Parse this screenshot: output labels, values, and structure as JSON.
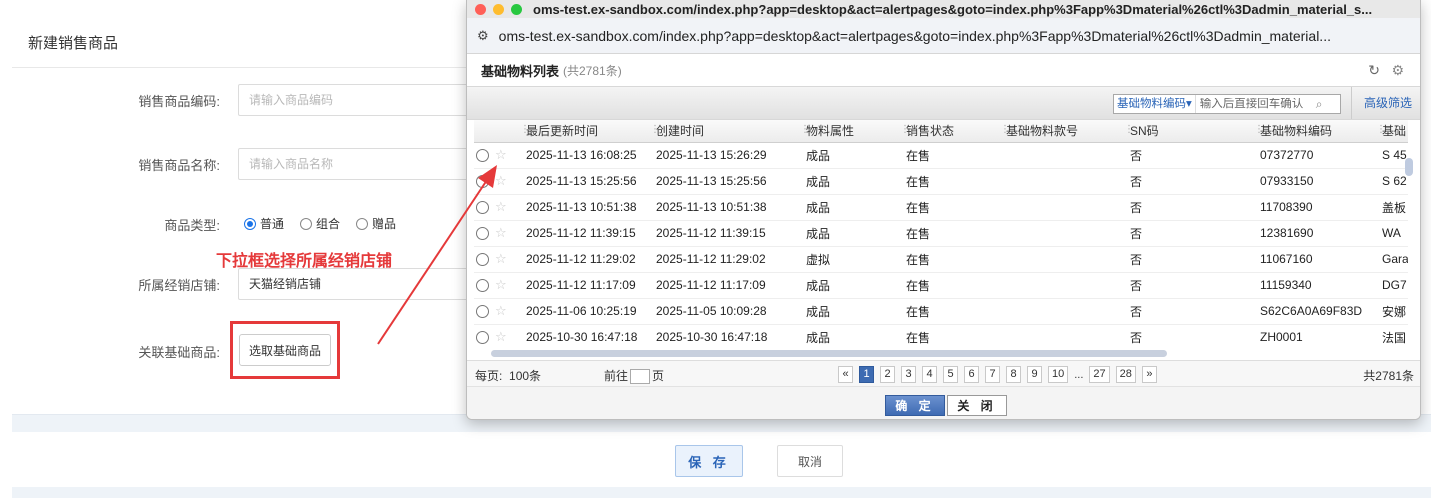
{
  "form": {
    "title": "新建销售商品",
    "code_label": "销售商品编码:",
    "code_placeholder": "请输入商品编码",
    "name_label": "销售商品名称:",
    "name_placeholder": "请输入商品名称",
    "type_label": "商品类型:",
    "type_options": [
      "普通",
      "组合",
      "赠品"
    ],
    "type_selected": "普通",
    "store_label": "所属经销店铺:",
    "store_value": "天猫经销店铺",
    "basic_label": "关联基础商品:",
    "pick_button": "选取基础商品",
    "annotation": "下拉框选择所属经销店铺",
    "save_button": "保 存",
    "cancel_button": "取消"
  },
  "popup": {
    "window_title": "oms-test.ex-sandbox.com/index.php?app=desktop&act=alertpages&goto=index.php%3Fapp%3Dmaterial%26ctl%3Dadmin_material_s...",
    "url": "oms-test.ex-sandbox.com/index.php?app=desktop&act=alertpages&goto=index.php%3Fapp%3Dmaterial%26ctl%3Dadmin_material...",
    "list_title": "基础物料列表",
    "list_count": "(共2781条)",
    "search_field": "基础物料编码▾",
    "search_placeholder": "输入后直接回车确认",
    "advanced_filter": "高级筛选",
    "columns": [
      "最后更新时间",
      "创建时间",
      "物料属性",
      "销售状态",
      "基础物料款号",
      "SN码",
      "基础物料编码",
      "基础"
    ],
    "rows": [
      [
        "2025-11-13 16:08:25",
        "2025-11-13 15:26:29",
        "成品",
        "在售",
        "",
        "否",
        "07372770",
        "S 45"
      ],
      [
        "2025-11-13 15:25:56",
        "2025-11-13 15:25:56",
        "成品",
        "在售",
        "",
        "否",
        "07933150",
        "S 62"
      ],
      [
        "2025-11-13 10:51:38",
        "2025-11-13 10:51:38",
        "成品",
        "在售",
        "",
        "否",
        "11708390",
        "盖板"
      ],
      [
        "2025-11-12 11:39:15",
        "2025-11-12 11:39:15",
        "成品",
        "在售",
        "",
        "否",
        "12381690",
        "WA"
      ],
      [
        "2025-11-12 11:29:02",
        "2025-11-12 11:29:02",
        "虚拟",
        "在售",
        "",
        "否",
        "11067160",
        "Gara"
      ],
      [
        "2025-11-12 11:17:09",
        "2025-11-12 11:17:09",
        "成品",
        "在售",
        "",
        "否",
        "11159340",
        "DG7"
      ],
      [
        "2025-11-06 10:25:19",
        "2025-11-05 10:09:28",
        "成品",
        "在售",
        "",
        "否",
        "S62C6A0A69F83D",
        "安娜"
      ],
      [
        "2025-10-30 16:47:18",
        "2025-10-30 16:47:18",
        "成品",
        "在售",
        "",
        "否",
        "ZH0001",
        "法国"
      ]
    ],
    "per_page_label": "每页:",
    "per_page_value": "100条",
    "goto_label": "前往",
    "page_unit": "页",
    "pages": [
      "«",
      "1",
      "2",
      "3",
      "4",
      "5",
      "6",
      "7",
      "8",
      "9",
      "10",
      "...",
      "27",
      "28",
      "»"
    ],
    "current_page": "1",
    "total": "共2781条",
    "ok_button": "确 定",
    "close_button": "关 闭"
  },
  "colors": {
    "annotation_red": "#e5393a",
    "primary_blue": "#3f6bb3",
    "link_blue": "#2a64b7"
  }
}
